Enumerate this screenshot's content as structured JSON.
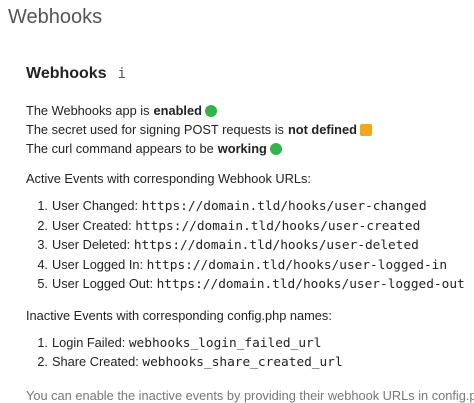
{
  "page": {
    "title": "Webhooks"
  },
  "section": {
    "title": "Webhooks",
    "info_icon_glyph": "i",
    "status": [
      {
        "text": "The Webhooks app is",
        "value": "enabled",
        "indicator": "green-circle",
        "color": "#34b34a"
      },
      {
        "text": "The secret used for signing POST requests is",
        "value": "not defined",
        "indicator": "amber-square",
        "color": "#f0a818"
      },
      {
        "text": "The curl command appears to be",
        "value": "working",
        "indicator": "green-circle",
        "color": "#34b34a"
      }
    ],
    "active_heading": "Active Events with corresponding Webhook URLs:",
    "active_events": [
      {
        "num": "1.",
        "label": "User Changed:",
        "url": "https://domain.tld/hooks/user-changed"
      },
      {
        "num": "2.",
        "label": "User Created:",
        "url": "https://domain.tld/hooks/user-created"
      },
      {
        "num": "3.",
        "label": "User Deleted:",
        "url": "https://domain.tld/hooks/user-deleted"
      },
      {
        "num": "4.",
        "label": "User Logged In:",
        "url": "https://domain.tld/hooks/user-logged-in"
      },
      {
        "num": "5.",
        "label": "User Logged Out:",
        "url": "https://domain.tld/hooks/user-logged-out"
      }
    ],
    "inactive_heading": "Inactive Events with corresponding config.php names:",
    "inactive_events": [
      {
        "num": "1.",
        "label": "Login Failed:",
        "name": "webhooks_login_failed_url"
      },
      {
        "num": "2.",
        "label": "Share Created:",
        "name": "webhooks_share_created_url"
      }
    ],
    "footer_note": "You can enable the inactive events by providing their webhook URLs in config.php"
  }
}
